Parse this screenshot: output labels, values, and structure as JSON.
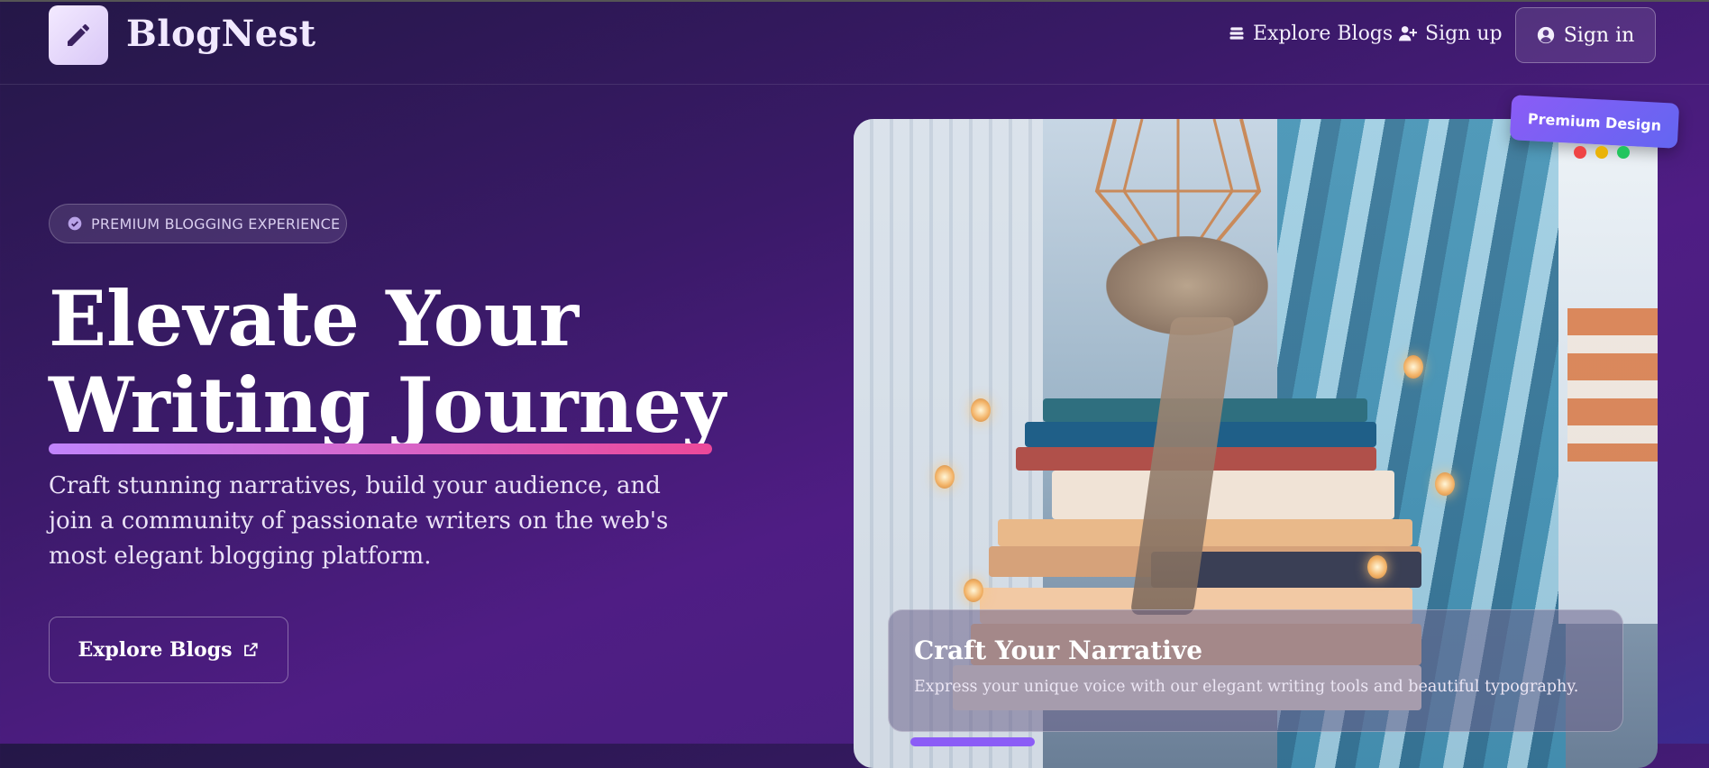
{
  "header": {
    "brand": "BlogNest",
    "nav": {
      "explore_label": "Explore Blogs",
      "signup_label": "Sign up",
      "signin_label": "Sign in"
    }
  },
  "hero": {
    "badge": "PREMIUM BLOGGING EXPERIENCE",
    "headline_line1": "Elevate Your",
    "headline_line2": "Writing Journey",
    "lead": "Craft stunning narratives, build your audience, and join a community of passionate writers on the web's most elegant blogging platform.",
    "cta_label": "Explore Blogs"
  },
  "card": {
    "premium_tag": "Premium Design",
    "overlay_title": "Craft Your Narrative",
    "overlay_desc": "Express your unique voice with our elegant writing tools and beautiful typography.",
    "dot_colors": [
      "#ef4444",
      "#eab308",
      "#22c55e"
    ]
  },
  "icons": {
    "logo": "pencil-icon",
    "explore": "layers-icon",
    "signup": "user-plus-icon",
    "signin": "user-circle-icon",
    "badge": "check-circle-icon",
    "cta": "external-link-icon"
  }
}
